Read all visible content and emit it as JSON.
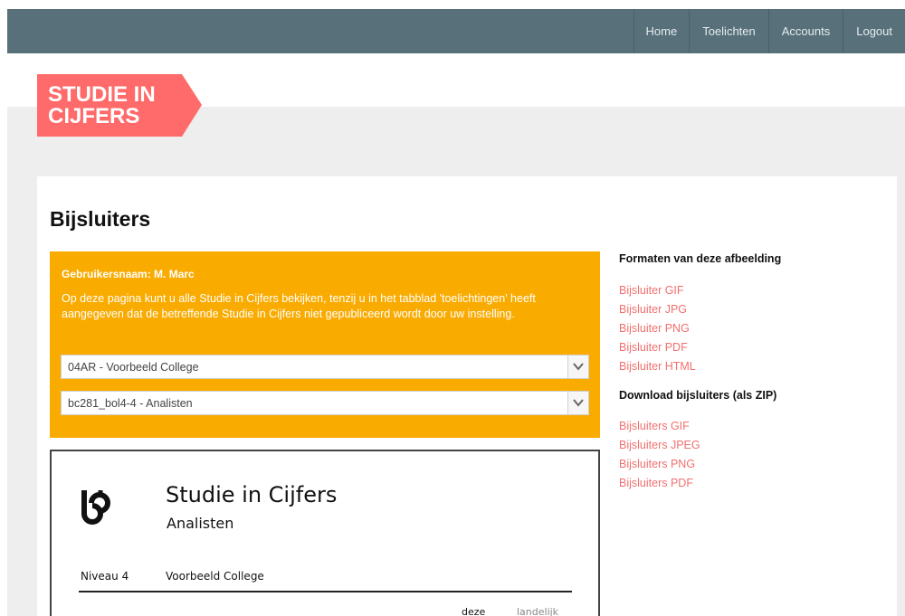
{
  "nav": {
    "items": [
      {
        "label": "Home"
      },
      {
        "label": "Toelichten"
      },
      {
        "label": "Accounts"
      },
      {
        "label": "Logout"
      }
    ]
  },
  "logo": {
    "line1": "STUDIE IN",
    "line2": "CIJFERS",
    "color": "#ff6a6a"
  },
  "page": {
    "title": "Bijsluiters"
  },
  "info": {
    "username": "Gebruikersnaam: M. Marc",
    "text": "Op deze pagina kunt u alle Studie in Cijfers bekijken, tenzij u in het tabblad 'toelichtingen' heeft aangegeven dat de betreffende Studie in Cijfers niet gepubliceerd wordt door uw instelling.",
    "select_institution": "04AR - Voorbeeld College",
    "select_study": "bc281_bol4-4 - Analisten"
  },
  "preview": {
    "title": "Studie in Cijfers",
    "subtitle": "Analisten",
    "niveau": "Niveau 4",
    "college": "Voorbeeld College",
    "col_deze": "deze",
    "col_landelijk": "landelijk"
  },
  "sidebar": {
    "formats_heading": "Formaten van deze afbeelding",
    "formats": [
      {
        "label": "Bijsluiter GIF"
      },
      {
        "label": "Bijsluiter JPG"
      },
      {
        "label": "Bijsluiter PNG"
      },
      {
        "label": "Bijsluiter PDF"
      },
      {
        "label": "Bijsluiter HTML"
      }
    ],
    "zip_heading": "Download bijsluiters (als ZIP)",
    "zips": [
      {
        "label": "Bijsluiters GIF"
      },
      {
        "label": "Bijsluiters JPEG"
      },
      {
        "label": "Bijsluiters PNG"
      },
      {
        "label": "Bijsluiters PDF"
      }
    ]
  },
  "colors": {
    "topbar": "#587079",
    "accent": "#f9ab00",
    "link": "#f2706f"
  }
}
